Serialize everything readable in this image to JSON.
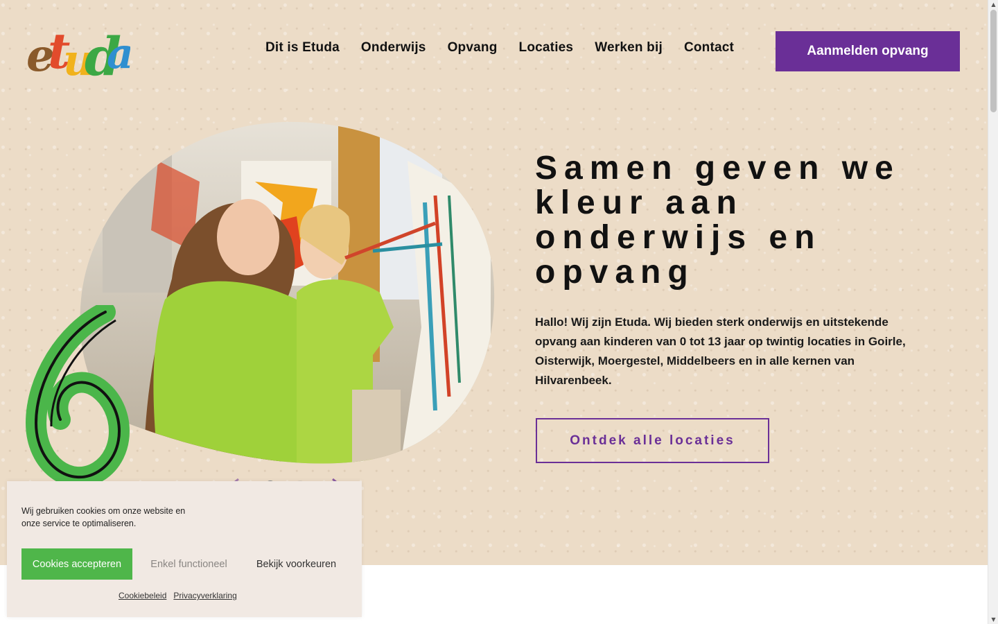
{
  "brand": {
    "logo_text": "etuda",
    "letter_colors": [
      "#8a5a2b",
      "#e24b2c",
      "#f1b21c",
      "#3ca845",
      "#2f8fd0"
    ]
  },
  "nav": {
    "items": [
      "Dit is Etuda",
      "Onderwijs",
      "Opvang",
      "Locaties",
      "Werken bij",
      "Contact"
    ],
    "cta_label": "Aanmelden opvang"
  },
  "hero": {
    "headline": "Samen geven we kleur aan onderwijs en opvang",
    "intro": "Hallo! Wij zijn Etuda. Wij bieden sterk onderwijs en uitstekende opvang aan kinderen van 0 tot 13 jaar op twintig locaties in Goirle, Oisterwijk, Moergestel, Middelbeers en in alle kernen van Hilvarenbeek.",
    "cta_label": "Ontdek alle locaties",
    "slider": {
      "slides": 2,
      "active": 1
    }
  },
  "cookie_banner": {
    "message": "Wij gebruiken cookies om onze website en onze service te optimaliseren.",
    "accept_label": "Cookies accepteren",
    "functional_label": "Enkel functioneel",
    "preferences_label": "Bekijk voorkeuren",
    "links": [
      "Cookiebeleid",
      "Privacyverklaring"
    ]
  },
  "colors": {
    "accent_purple": "#6a2f97",
    "accept_green": "#4fb64a",
    "hero_bg": "#ecdcc7",
    "cookie_bg": "#f1e9e3"
  },
  "icons": {
    "prev": "chevron-left-icon",
    "next": "chevron-right-icon",
    "decoration": "green-swirl"
  }
}
